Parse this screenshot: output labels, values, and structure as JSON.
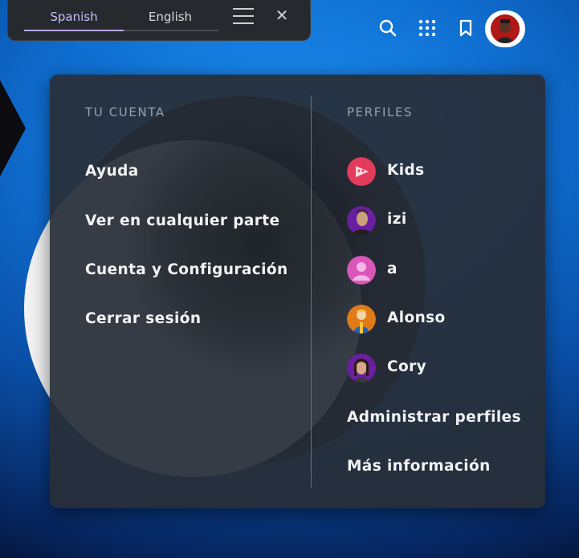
{
  "translator": {
    "tabs": [
      {
        "label": "Spanish",
        "active": true
      },
      {
        "label": "English",
        "active": false
      }
    ]
  },
  "header": {
    "icons": [
      "search-icon",
      "apps-grid-icon",
      "bookmark-icon",
      "profile-avatar"
    ]
  },
  "menu": {
    "account": {
      "title": "TU CUENTA",
      "items": [
        {
          "label": "Ayuda"
        },
        {
          "label": "Ver en cualquier parte"
        },
        {
          "label": "Cuenta y Configuración"
        },
        {
          "label": "Cerrar sesión"
        }
      ]
    },
    "profiles": {
      "title": "PERFILES",
      "items": [
        {
          "name": "Kids",
          "avatar_color": "#e23b5c"
        },
        {
          "name": "izi",
          "avatar_color": "#6a1fa0"
        },
        {
          "name": "a",
          "avatar_color": "#d957b8"
        },
        {
          "name": "Alonso",
          "avatar_color": "#e07b1a"
        },
        {
          "name": "Cory",
          "avatar_color": "#6a1fa0"
        }
      ],
      "links": [
        {
          "label": "Administrar perfiles"
        },
        {
          "label": "Más información"
        }
      ]
    }
  },
  "colors": {
    "accent": "#b8acf4",
    "panel": "#282e38",
    "background": "#1b8ff0"
  }
}
